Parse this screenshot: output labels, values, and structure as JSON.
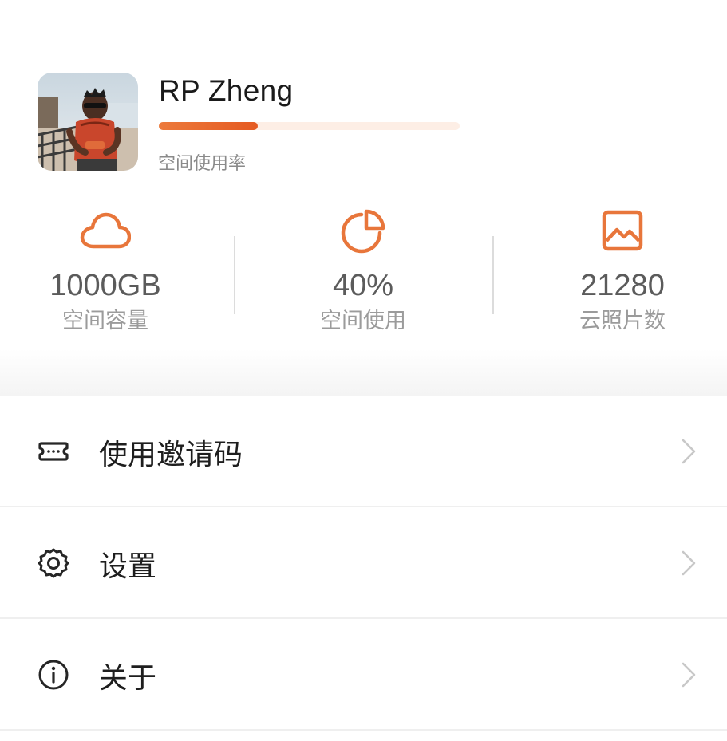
{
  "profile": {
    "username": "RP Zheng",
    "usage_label": "空间使用率",
    "usage_fraction": 0.33
  },
  "stats": [
    {
      "icon": "cloud-icon",
      "value": "1000GB",
      "label": "空间容量"
    },
    {
      "icon": "pie-chart-icon",
      "value": "40%",
      "label": "空间使用"
    },
    {
      "icon": "photo-icon",
      "value": "21280",
      "label": "云照片数"
    }
  ],
  "menu": [
    {
      "icon": "ticket-icon",
      "label": "使用邀请码"
    },
    {
      "icon": "gear-icon",
      "label": "设置"
    },
    {
      "icon": "info-icon",
      "label": "关于"
    }
  ],
  "colors": {
    "accent": "#e8763b",
    "progress_start": "#ec7a3c",
    "progress_end": "#e55a21",
    "progress_track": "#fdeee5"
  }
}
